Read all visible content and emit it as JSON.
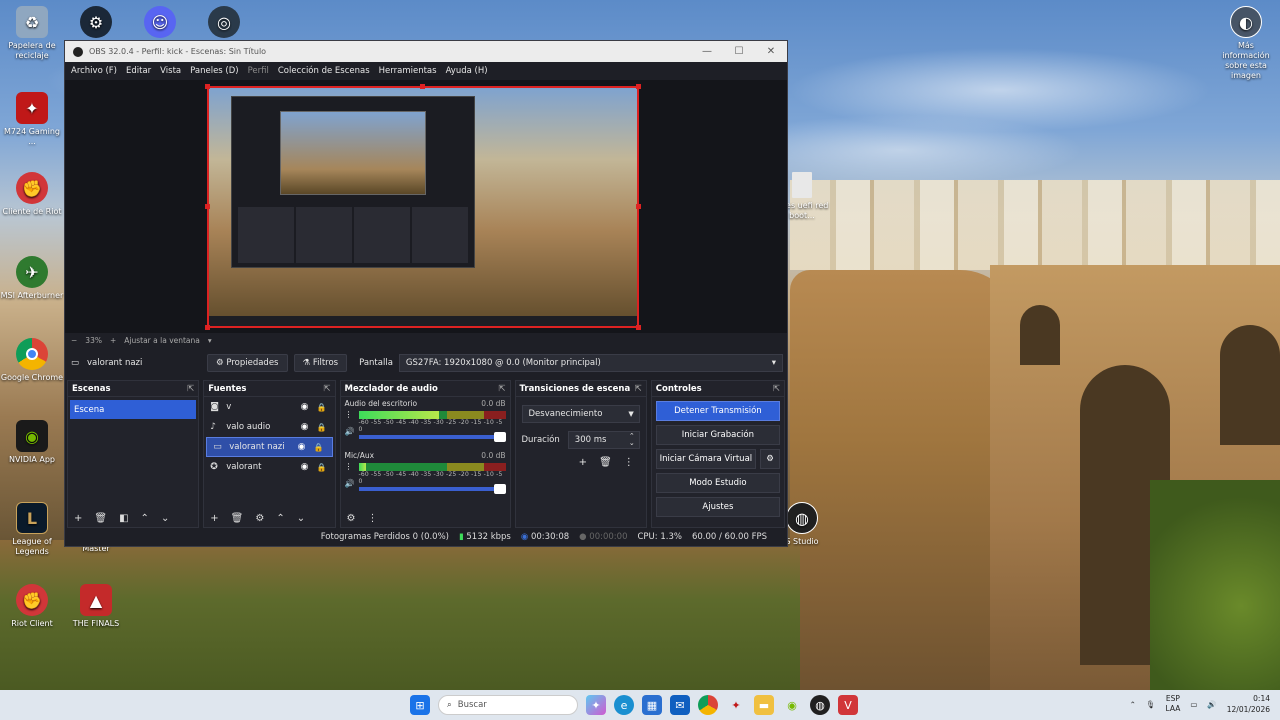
{
  "desktop": {
    "icons": [
      {
        "label": "Papelera de reciclaje",
        "icon": "recycle-bin-icon",
        "color": "#8fa7c0",
        "glyph": "♻"
      },
      {
        "label": "Steam",
        "icon": "steam-icon",
        "color": "#1b2838",
        "glyph": "⚙"
      },
      {
        "label": "Discord",
        "icon": "discord-icon",
        "color": "#5865f2",
        "glyph": "☺"
      },
      {
        "label": "",
        "icon": "spiral-app-icon",
        "color": "#2a3a4a",
        "glyph": "◎"
      },
      {
        "label": "M724 Gaming ...",
        "icon": "redragon-icon",
        "color": "#c01818",
        "glyph": "✦"
      },
      {
        "label": "Cliente de Riot",
        "icon": "riot-client-icon",
        "color": "#d13639",
        "glyph": "✊"
      },
      {
        "label": "MSI Afterburner",
        "icon": "msi-afterburner-icon",
        "color": "#2f7a2f",
        "glyph": "✈"
      },
      {
        "label": "Google Chrome",
        "icon": "chrome-icon",
        "color": "#2a8a3a",
        "glyph": "●"
      },
      {
        "label": "NVIDIA App",
        "icon": "nvidia-icon",
        "color": "#3a7a10",
        "glyph": "◉"
      },
      {
        "label": "League of Legends",
        "icon": "league-icon",
        "color": "#b48a3a",
        "glyph": "L"
      },
      {
        "label": "Master",
        "icon": "",
        "color": "",
        "glyph": ""
      },
      {
        "label": "Riot Client",
        "icon": "riot-client-2-icon",
        "color": "#d13639",
        "glyph": "✊"
      },
      {
        "label": "THE FINALS",
        "icon": "the-finals-icon",
        "color": "#c42a2a",
        "glyph": "▲"
      },
      {
        "label": "Más información sobre esta imagen",
        "icon": "camera-icon",
        "color": "#3a3a3a",
        "glyph": "◐"
      },
      {
        "label": "uires uefi red boot...",
        "icon": "file-icon",
        "color": "#e8e8e8",
        "glyph": ""
      },
      {
        "label": "S Studio",
        "icon": "obs-studio-icon",
        "color": "#202020",
        "glyph": "◍"
      }
    ]
  },
  "obs": {
    "title": "OBS 32.0.4 - Perfil: kick - Escenas: Sin Título",
    "menu": [
      "Archivo (F)",
      "Editar",
      "Vista",
      "Paneles (D)",
      "Perfil",
      "Colección de Escenas",
      "Herramientas",
      "Ayuda (H)"
    ],
    "zoom": {
      "value": "33%",
      "fit_label": "Ajustar a la ventana"
    },
    "source_bar": {
      "name": "valorant nazi",
      "properties_label": "Propiedades",
      "filters_label": "Filtros",
      "type_label": "Pantalla",
      "display_value": "GS27FA: 1920x1080 @ 0.0 (Monitor principal)"
    },
    "scenes": {
      "title": "Escenas",
      "items": [
        "Escena"
      ]
    },
    "sources": {
      "title": "Fuentes",
      "items": [
        {
          "name": "v",
          "icon": "camera-icon",
          "glyph": "◙"
        },
        {
          "name": "valo audio",
          "icon": "microphone-icon",
          "glyph": "♪"
        },
        {
          "name": "valorant nazi",
          "icon": "monitor-icon",
          "glyph": "▭"
        },
        {
          "name": "valorant",
          "icon": "gamepad-icon",
          "glyph": "✪"
        }
      ]
    },
    "mixer": {
      "title": "Mezclador de audio",
      "channels": [
        {
          "name": "Audio del escritorio",
          "db": "0.0 dB",
          "level": 0.55
        },
        {
          "name": "Mic/Aux",
          "db": "0.0 dB",
          "level": 0.05
        }
      ],
      "scale": "-60 -55 -50 -45 -40 -35 -30 -25 -20 -15 -10 -5 0"
    },
    "transitions": {
      "title": "Transiciones de escena",
      "selected": "Desvanecimiento",
      "duration_label": "Duración",
      "duration_value": "300 ms"
    },
    "controls": {
      "title": "Controles",
      "buttons": [
        "Detener Transmisión",
        "Iniciar Grabación",
        "Iniciar Cámara Virtual",
        "Modo Estudio",
        "Ajustes"
      ]
    },
    "status": {
      "dropped": "Fotogramas Perdidos 0 (0.0%)",
      "bitrate": "5132 kbps",
      "stream_time": "00:30:08",
      "rec_time": "00:00:00",
      "cpu": "CPU: 1.3%",
      "fps": "60.00 / 60.00 FPS"
    }
  },
  "taskbar": {
    "search_placeholder": "Buscar",
    "lang_top": "ESP",
    "lang_bottom": "LAA",
    "time": "0:14",
    "date": "12/01/2026"
  },
  "colors": {
    "accent": "#2f5fd6",
    "selection_red": "#dd2222",
    "panel": "#22232b"
  }
}
